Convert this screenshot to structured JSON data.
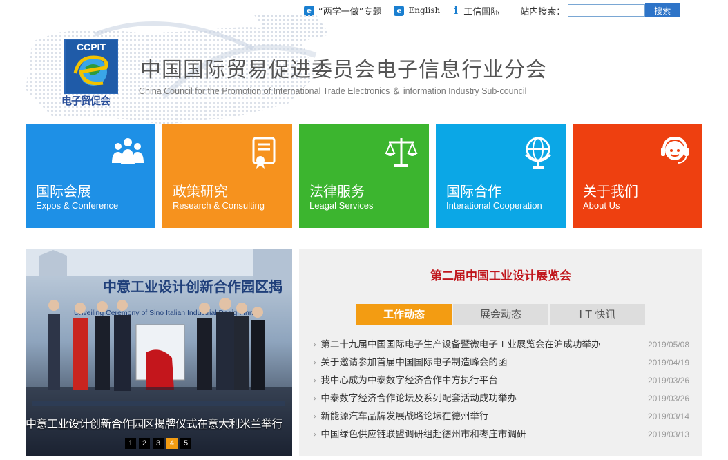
{
  "topbar": {
    "links": [
      {
        "label": "“两学一做”专题"
      },
      {
        "label": "English"
      },
      {
        "label": "工信国际"
      }
    ],
    "search_label": "站内搜索：",
    "search_placeholder": "",
    "search_button": "搜索"
  },
  "header": {
    "logo_top": "CCPIT",
    "logo_bottom": "电子贸促会",
    "title": "中国国际贸易促进委员会电子信息行业分会",
    "subtitle": "China Council for the Promotion of International Trade Electronics ＆ information Industry Sub-council"
  },
  "tiles": [
    {
      "zh": "国际会展",
      "en": "Expos & Conference",
      "color": "#1e90e6",
      "icon": "people-group-icon"
    },
    {
      "zh": "政策研究",
      "en": "Research & Consulting",
      "color": "#f6921e",
      "icon": "certificate-icon"
    },
    {
      "zh": "法律服务",
      "en": "Leagal Services",
      "color": "#3cb52f",
      "icon": "scales-icon"
    },
    {
      "zh": "国际合作",
      "en": "Interational Cooperation",
      "color": "#0ba7e6",
      "icon": "globe-icon"
    },
    {
      "zh": "关于我们",
      "en": "About Us",
      "color": "#ee4010",
      "icon": "support-agent-icon"
    }
  ],
  "slide": {
    "banner_text": "中意工业设计创新合作园区揭",
    "banner_sub": "Unveiling Ceremony of Sino Italian Industrial Design Innov",
    "caption": "中意工业设计创新合作园区揭牌仪式在意大利米兰举行",
    "pages": [
      "1",
      "2",
      "3",
      "4",
      "5"
    ],
    "active_page": "4"
  },
  "panel": {
    "title": "第二届中国工业设计展览会",
    "tabs": [
      {
        "label": "工作动态"
      },
      {
        "label": "展会动态"
      },
      {
        "label": "I T 快讯"
      }
    ],
    "news": [
      {
        "title": "第二十九届中国国际电子生产设备暨微电子工业展览会在沪成功举办",
        "date": "2019/05/08"
      },
      {
        "title": "关于邀请参加首届中国国际电子制造峰会的函",
        "date": "2019/04/19"
      },
      {
        "title": "我中心成为中泰数字经济合作中方执行平台",
        "date": "2019/03/26"
      },
      {
        "title": "中泰数字经济合作论坛及系列配套活动成功举办",
        "date": "2019/03/26"
      },
      {
        "title": "新能源汽车品牌发展战略论坛在德州举行",
        "date": "2019/03/14"
      },
      {
        "title": "中国绿色供应链联盟调研组赴德州市和枣庄市调研",
        "date": "2019/03/13"
      }
    ]
  }
}
